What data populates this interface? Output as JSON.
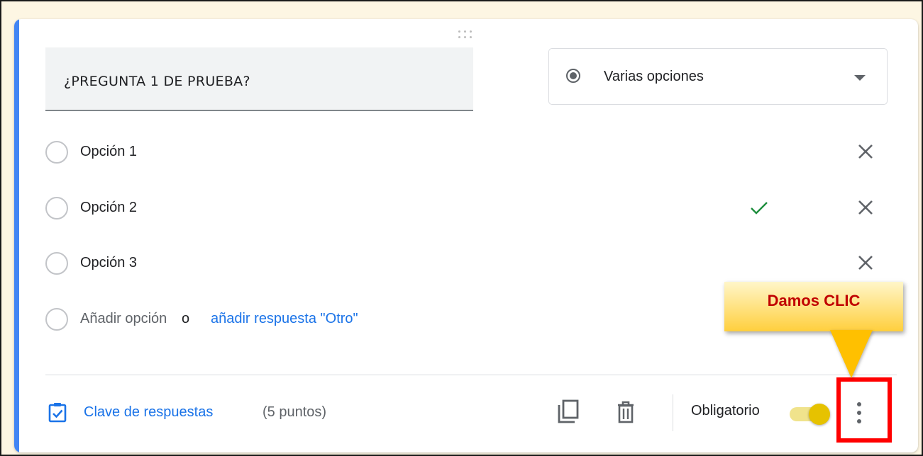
{
  "question": {
    "title": "¿PREGUNTA 1 DE PRUEBA?",
    "type_label": "Varias opciones"
  },
  "options": [
    {
      "label": "Opción 1",
      "correct": false
    },
    {
      "label": "Opción 2",
      "correct": true
    },
    {
      "label": "Opción 3",
      "correct": false
    }
  ],
  "add_option": {
    "label": "Añadir opción",
    "or": "o",
    "other_link": "añadir respuesta \"Otro\""
  },
  "footer": {
    "answer_key_label": "Clave de respuestas",
    "points": "(5 puntos)",
    "required_label": "Obligatorio",
    "required_on": true
  },
  "annotation": {
    "callout_text": "Damos CLIC"
  },
  "colors": {
    "accent": "#4285f4",
    "link": "#1a73e8",
    "check": "#1e8e3e",
    "toggle": "#e6c200",
    "highlight": "#ff0000",
    "callout_text": "#c00000"
  },
  "icons": [
    "drag-handle-icon",
    "radio-filled-icon",
    "dropdown-caret-icon",
    "radio-empty-icon",
    "close-icon",
    "check-icon",
    "answer-key-icon",
    "copy-icon",
    "trash-icon",
    "more-vert-icon"
  ]
}
